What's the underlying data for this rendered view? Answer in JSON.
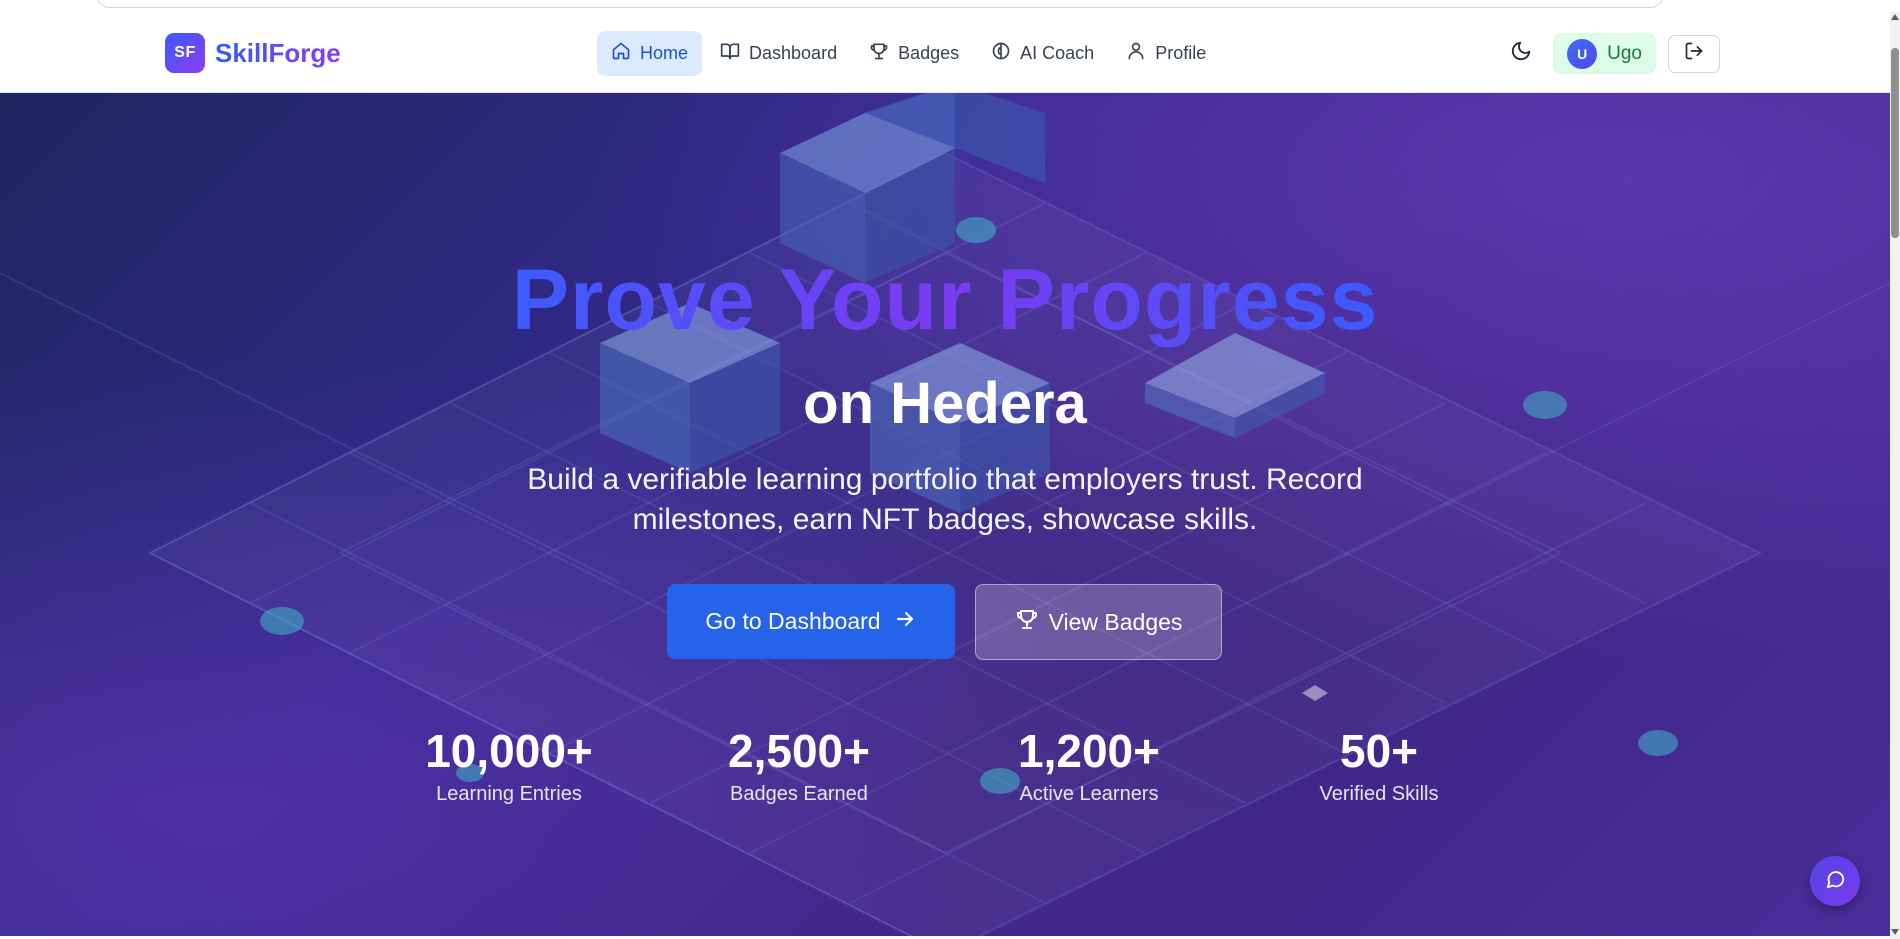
{
  "brand": {
    "logo_text": "SF",
    "name": "SkillForge"
  },
  "nav": {
    "items": [
      {
        "label": "Home",
        "icon": "home-icon",
        "active": true
      },
      {
        "label": "Dashboard",
        "icon": "book-open-icon",
        "active": false
      },
      {
        "label": "Badges",
        "icon": "trophy-icon",
        "active": false
      },
      {
        "label": "AI Coach",
        "icon": "brain-icon",
        "active": false
      },
      {
        "label": "Profile",
        "icon": "user-icon",
        "active": false
      }
    ]
  },
  "user": {
    "initial": "U",
    "name": "Ugo"
  },
  "hero": {
    "title": "Prove Your Progress",
    "subtitle": "on Hedera",
    "description": "Build a verifiable learning portfolio that employers trust. Record milestones, earn NFT badges, showcase skills.",
    "primary_button": "Go to Dashboard",
    "secondary_button": "View Badges"
  },
  "stats": [
    {
      "value": "10,000+",
      "label": "Learning Entries"
    },
    {
      "value": "2,500+",
      "label": "Badges Earned"
    },
    {
      "value": "1,200+",
      "label": "Active Learners"
    },
    {
      "value": "50+",
      "label": "Verified Skills"
    }
  ],
  "colors": {
    "accent": "#2563eb",
    "brand_gradient_start": "#3b5bfd",
    "brand_gradient_end": "#8b3cf0",
    "active_nav_bg": "#dbeafe",
    "user_chip_bg": "#dcfce7",
    "user_name": "#15803d"
  }
}
